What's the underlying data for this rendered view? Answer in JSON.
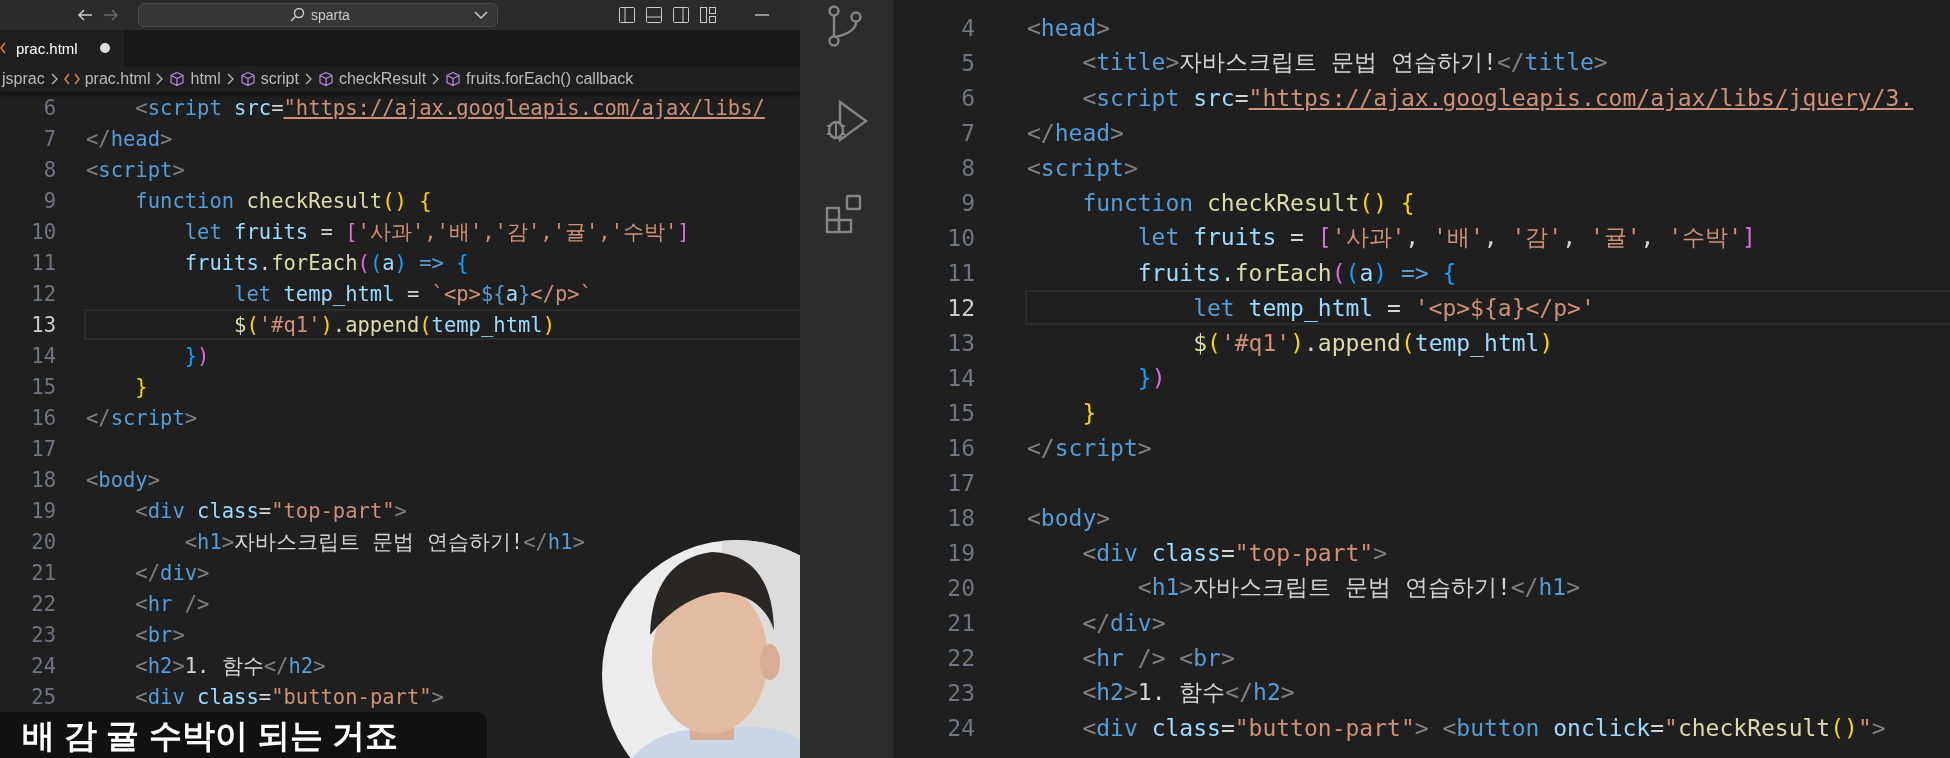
{
  "left_window": {
    "title_bar": {
      "search_label": "sparta"
    },
    "tabs": [
      {
        "label": "prac.html",
        "selected": true,
        "modified": true
      }
    ],
    "breadcrumbs": [
      {
        "label": "jsprac",
        "kind": "folder"
      },
      {
        "label": "prac.html",
        "kind": "file"
      },
      {
        "label": "html",
        "kind": "symbol"
      },
      {
        "label": "script",
        "kind": "symbol"
      },
      {
        "label": "checkResult",
        "kind": "symbol"
      },
      {
        "label": "fruits.forEach() callback",
        "kind": "symbol"
      }
    ],
    "editor": {
      "lines": [
        {
          "number": "6",
          "current": false,
          "code": [
            {
              "text": "    <",
              "kind": "punct"
            },
            {
              "text": "script",
              "kind": "tag"
            },
            {
              "text": " src",
              "kind": "attr"
            },
            {
              "text": "=",
              "kind": "op"
            },
            {
              "text": "\"https://ajax.googleapis.com/ajax/libs/",
              "kind": "link"
            }
          ]
        },
        {
          "number": "7",
          "current": false,
          "code": [
            {
              "text": "</",
              "kind": "punct"
            },
            {
              "text": "head",
              "kind": "tag"
            },
            {
              "text": ">",
              "kind": "punct"
            }
          ]
        },
        {
          "number": "8",
          "current": false,
          "code": [
            {
              "text": "<",
              "kind": "punct"
            },
            {
              "text": "script",
              "kind": "tag"
            },
            {
              "text": ">",
              "kind": "punct"
            }
          ]
        },
        {
          "number": "9",
          "current": false,
          "code": [
            {
              "text": "    function ",
              "kind": "kw"
            },
            {
              "text": "checkResult",
              "kind": "fn"
            },
            {
              "text": "() {",
              "kind": "br1"
            }
          ]
        },
        {
          "number": "10",
          "current": false,
          "code": [
            {
              "text": "        let",
              "kind": "kw"
            },
            {
              "text": " fruits",
              "kind": "var"
            },
            {
              "text": " = ",
              "kind": "op"
            },
            {
              "text": "[",
              "kind": "br2"
            },
            {
              "text": "'사과','배','감','귤','수박'",
              "kind": "str"
            },
            {
              "text": "]",
              "kind": "br2"
            }
          ]
        },
        {
          "number": "11",
          "current": false,
          "code": [
            {
              "text": "        fruits",
              "kind": "var"
            },
            {
              "text": ".",
              "kind": "op"
            },
            {
              "text": "forEach",
              "kind": "fn"
            },
            {
              "text": "(",
              "kind": "br2"
            },
            {
              "text": "(",
              "kind": "br3"
            },
            {
              "text": "a",
              "kind": "var"
            },
            {
              "text": ")",
              "kind": "br3"
            },
            {
              "text": " => ",
              "kind": "kw"
            },
            {
              "text": "{",
              "kind": "br3"
            }
          ]
        },
        {
          "number": "12",
          "current": false,
          "code": [
            {
              "text": "            let",
              "kind": "kw"
            },
            {
              "text": " temp_html",
              "kind": "var"
            },
            {
              "text": " = ",
              "kind": "op"
            },
            {
              "text": "`<p>",
              "kind": "str"
            },
            {
              "text": "${",
              "kind": "kw"
            },
            {
              "text": "a",
              "kind": "var"
            },
            {
              "text": "}",
              "kind": "kw"
            },
            {
              "text": "</p>`",
              "kind": "str"
            }
          ]
        },
        {
          "number": "13",
          "current": true,
          "code": [
            {
              "text": "            $",
              "kind": "fn"
            },
            {
              "text": "(",
              "kind": "br1"
            },
            {
              "text": "'#q1'",
              "kind": "str"
            },
            {
              "text": ")",
              "kind": "br1"
            },
            {
              "text": ".",
              "kind": "op"
            },
            {
              "text": "append",
              "kind": "fn"
            },
            {
              "text": "(",
              "kind": "br1"
            },
            {
              "text": "temp_html",
              "kind": "var"
            },
            {
              "text": ")",
              "kind": "br1"
            }
          ]
        },
        {
          "number": "14",
          "current": false,
          "code": [
            {
              "text": "        }",
              "kind": "br3"
            },
            {
              "text": ")",
              "kind": "br2"
            }
          ]
        },
        {
          "number": "15",
          "current": false,
          "code": [
            {
              "text": "    }",
              "kind": "br1"
            }
          ]
        },
        {
          "number": "16",
          "current": false,
          "code": [
            {
              "text": "</",
              "kind": "punct"
            },
            {
              "text": "script",
              "kind": "tag"
            },
            {
              "text": ">",
              "kind": "punct"
            }
          ]
        },
        {
          "number": "17",
          "current": false
        },
        {
          "number": "18",
          "current": false,
          "code": [
            {
              "text": "<",
              "kind": "punct"
            },
            {
              "text": "body",
              "kind": "tag"
            },
            {
              "text": ">",
              "kind": "punct"
            }
          ]
        },
        {
          "number": "19",
          "current": false,
          "code": [
            {
              "text": "    <",
              "kind": "punct"
            },
            {
              "text": "div",
              "kind": "tag"
            },
            {
              "text": " class",
              "kind": "attr"
            },
            {
              "text": "=",
              "kind": "op"
            },
            {
              "text": "\"top-part\"",
              "kind": "str"
            },
            {
              "text": ">",
              "kind": "punct"
            }
          ]
        },
        {
          "number": "20",
          "current": false,
          "code": [
            {
              "text": "        <",
              "kind": "punct"
            },
            {
              "text": "h1",
              "kind": "tag"
            },
            {
              "text": ">",
              "kind": "punct"
            },
            {
              "text": "자바스크립트 문법 연습하기!",
              "kind": "text"
            },
            {
              "text": "</",
              "kind": "punct"
            },
            {
              "text": "h1",
              "kind": "tag"
            },
            {
              "text": ">",
              "kind": "punct"
            }
          ]
        },
        {
          "number": "21",
          "current": false,
          "code": [
            {
              "text": "    </",
              "kind": "punct"
            },
            {
              "text": "div",
              "kind": "tag"
            },
            {
              "text": ">",
              "kind": "punct"
            }
          ]
        },
        {
          "number": "22",
          "current": false,
          "code": [
            {
              "text": "    <",
              "kind": "punct"
            },
            {
              "text": "hr",
              "kind": "tag"
            },
            {
              "text": " />",
              "kind": "punct"
            }
          ]
        },
        {
          "number": "23",
          "current": false,
          "code": [
            {
              "text": "    <",
              "kind": "punct"
            },
            {
              "text": "br",
              "kind": "tag"
            },
            {
              "text": ">",
              "kind": "punct"
            }
          ]
        },
        {
          "number": "24",
          "current": false,
          "code": [
            {
              "text": "    <",
              "kind": "punct"
            },
            {
              "text": "h2",
              "kind": "tag"
            },
            {
              "text": ">",
              "kind": "punct"
            },
            {
              "text": "1. 함수",
              "kind": "text"
            },
            {
              "text": "</",
              "kind": "punct"
            },
            {
              "text": "h2",
              "kind": "tag"
            },
            {
              "text": ">",
              "kind": "punct"
            }
          ]
        },
        {
          "number": "25",
          "current": false,
          "code": [
            {
              "text": "    <",
              "kind": "punct"
            },
            {
              "text": "div",
              "kind": "tag"
            },
            {
              "text": " class",
              "kind": "attr"
            },
            {
              "text": "=",
              "kind": "op"
            },
            {
              "text": "\"button-part\"",
              "kind": "str"
            },
            {
              "text": ">",
              "kind": "punct"
            }
          ]
        }
      ]
    }
  },
  "right_window": {
    "editor": {
      "lines": [
        {
          "number": "4",
          "current": false,
          "code": [
            {
              "text": "<",
              "kind": "punct"
            },
            {
              "text": "head",
              "kind": "tag"
            },
            {
              "text": ">",
              "kind": "punct"
            }
          ]
        },
        {
          "number": "5",
          "current": false,
          "code": [
            {
              "text": "    <",
              "kind": "punct"
            },
            {
              "text": "title",
              "kind": "tag"
            },
            {
              "text": ">",
              "kind": "punct"
            },
            {
              "text": "자바스크립트 문법 연습하기!",
              "kind": "text"
            },
            {
              "text": "</",
              "kind": "punct"
            },
            {
              "text": "title",
              "kind": "tag"
            },
            {
              "text": ">",
              "kind": "punct"
            }
          ]
        },
        {
          "number": "6",
          "current": false,
          "code": [
            {
              "text": "    <",
              "kind": "punct"
            },
            {
              "text": "script",
              "kind": "tag"
            },
            {
              "text": " src",
              "kind": "attr"
            },
            {
              "text": "=",
              "kind": "op"
            },
            {
              "text": "\"https://ajax.googleapis.com/ajax/libs/jquery/3.",
              "kind": "link"
            }
          ]
        },
        {
          "number": "7",
          "current": false,
          "code": [
            {
              "text": "</",
              "kind": "punct"
            },
            {
              "text": "head",
              "kind": "tag"
            },
            {
              "text": ">",
              "kind": "punct"
            }
          ]
        },
        {
          "number": "8",
          "current": false,
          "code": [
            {
              "text": "<",
              "kind": "punct"
            },
            {
              "text": "script",
              "kind": "tag"
            },
            {
              "text": ">",
              "kind": "punct"
            }
          ]
        },
        {
          "number": "9",
          "current": false,
          "code": [
            {
              "text": "    function ",
              "kind": "kw"
            },
            {
              "text": "checkResult",
              "kind": "fn"
            },
            {
              "text": "() {",
              "kind": "br1"
            }
          ]
        },
        {
          "number": "10",
          "current": false,
          "code": [
            {
              "text": "        let",
              "kind": "kw"
            },
            {
              "text": " fruits",
              "kind": "var"
            },
            {
              "text": " = ",
              "kind": "op"
            },
            {
              "text": "[",
              "kind": "br2"
            },
            {
              "text": "'사과'",
              "kind": "str"
            },
            {
              "text": ", ",
              "kind": "op"
            },
            {
              "text": "'배'",
              "kind": "str"
            },
            {
              "text": ", ",
              "kind": "op"
            },
            {
              "text": "'감'",
              "kind": "str"
            },
            {
              "text": ", ",
              "kind": "op"
            },
            {
              "text": "'귤'",
              "kind": "str"
            },
            {
              "text": ", ",
              "kind": "op"
            },
            {
              "text": "'수박'",
              "kind": "str"
            },
            {
              "text": "]",
              "kind": "br2"
            }
          ]
        },
        {
          "number": "11",
          "current": false,
          "code": [
            {
              "text": "        fruits",
              "kind": "var"
            },
            {
              "text": ".",
              "kind": "op"
            },
            {
              "text": "forEach",
              "kind": "fn"
            },
            {
              "text": "(",
              "kind": "br2"
            },
            {
              "text": "(",
              "kind": "br3"
            },
            {
              "text": "a",
              "kind": "var"
            },
            {
              "text": ")",
              "kind": "br3"
            },
            {
              "text": " => ",
              "kind": "kw"
            },
            {
              "text": "{",
              "kind": "br3"
            }
          ]
        },
        {
          "number": "12",
          "current": true,
          "code": [
            {
              "text": "            let",
              "kind": "kw"
            },
            {
              "text": " temp_html",
              "kind": "var"
            },
            {
              "text": " = ",
              "kind": "op"
            },
            {
              "text": "'<p>${a}</p>'",
              "kind": "str"
            }
          ]
        },
        {
          "number": "13",
          "current": false,
          "code": [
            {
              "text": "            $",
              "kind": "fn"
            },
            {
              "text": "(",
              "kind": "br1"
            },
            {
              "text": "'#q1'",
              "kind": "str"
            },
            {
              "text": ")",
              "kind": "br1"
            },
            {
              "text": ".",
              "kind": "op"
            },
            {
              "text": "append",
              "kind": "fn"
            },
            {
              "text": "(",
              "kind": "br1"
            },
            {
              "text": "temp_html",
              "kind": "var"
            },
            {
              "text": ")",
              "kind": "br1"
            }
          ]
        },
        {
          "number": "14",
          "current": false,
          "code": [
            {
              "text": "        }",
              "kind": "br3"
            },
            {
              "text": ")",
              "kind": "br2"
            }
          ]
        },
        {
          "number": "15",
          "current": false,
          "code": [
            {
              "text": "    }",
              "kind": "br1"
            }
          ]
        },
        {
          "number": "16",
          "current": false,
          "code": [
            {
              "text": "</",
              "kind": "punct"
            },
            {
              "text": "script",
              "kind": "tag"
            },
            {
              "text": ">",
              "kind": "punct"
            }
          ]
        },
        {
          "number": "17",
          "current": false
        },
        {
          "number": "18",
          "current": false,
          "code": [
            {
              "text": "<",
              "kind": "punct"
            },
            {
              "text": "body",
              "kind": "tag"
            },
            {
              "text": ">",
              "kind": "punct"
            }
          ]
        },
        {
          "number": "19",
          "current": false,
          "code": [
            {
              "text": "    <",
              "kind": "punct"
            },
            {
              "text": "div",
              "kind": "tag"
            },
            {
              "text": " class",
              "kind": "attr"
            },
            {
              "text": "=",
              "kind": "op"
            },
            {
              "text": "\"top-part\"",
              "kind": "str"
            },
            {
              "text": ">",
              "kind": "punct"
            }
          ]
        },
        {
          "number": "20",
          "current": false,
          "code": [
            {
              "text": "        <",
              "kind": "punct"
            },
            {
              "text": "h1",
              "kind": "tag"
            },
            {
              "text": ">",
              "kind": "punct"
            },
            {
              "text": "자바스크립트 문법 연습하기!",
              "kind": "text"
            },
            {
              "text": "</",
              "kind": "punct"
            },
            {
              "text": "h1",
              "kind": "tag"
            },
            {
              "text": ">",
              "kind": "punct"
            }
          ]
        },
        {
          "number": "21",
          "current": false,
          "code": [
            {
              "text": "    </",
              "kind": "punct"
            },
            {
              "text": "div",
              "kind": "tag"
            },
            {
              "text": ">",
              "kind": "punct"
            }
          ]
        },
        {
          "number": "22",
          "current": false,
          "code": [
            {
              "text": "    <",
              "kind": "punct"
            },
            {
              "text": "hr",
              "kind": "tag"
            },
            {
              "text": " /> ",
              "kind": "punct"
            },
            {
              "text": "<",
              "kind": "punct"
            },
            {
              "text": "br",
              "kind": "tag"
            },
            {
              "text": ">",
              "kind": "punct"
            }
          ]
        },
        {
          "number": "23",
          "current": false,
          "code": [
            {
              "text": "    <",
              "kind": "punct"
            },
            {
              "text": "h2",
              "kind": "tag"
            },
            {
              "text": ">",
              "kind": "punct"
            },
            {
              "text": "1. 함수",
              "kind": "text"
            },
            {
              "text": "</",
              "kind": "punct"
            },
            {
              "text": "h2",
              "kind": "tag"
            },
            {
              "text": ">",
              "kind": "punct"
            }
          ]
        },
        {
          "number": "24",
          "current": false,
          "code": [
            {
              "text": "    <",
              "kind": "punct"
            },
            {
              "text": "div",
              "kind": "tag"
            },
            {
              "text": " class",
              "kind": "attr"
            },
            {
              "text": "=",
              "kind": "op"
            },
            {
              "text": "\"button-part\"",
              "kind": "str"
            },
            {
              "text": "> <",
              "kind": "punct"
            },
            {
              "text": "button",
              "kind": "tag"
            },
            {
              "text": " onclick",
              "kind": "attr"
            },
            {
              "text": "=",
              "kind": "op"
            },
            {
              "text": "\"",
              "kind": "str"
            },
            {
              "text": "checkResult",
              "kind": "fn"
            },
            {
              "text": "()",
              "kind": "br1"
            },
            {
              "text": "\"",
              "kind": "str"
            },
            {
              "text": ">",
              "kind": "punct"
            }
          ]
        }
      ]
    }
  },
  "subtitle": "배 감 귤 수박이 되는 거죠"
}
